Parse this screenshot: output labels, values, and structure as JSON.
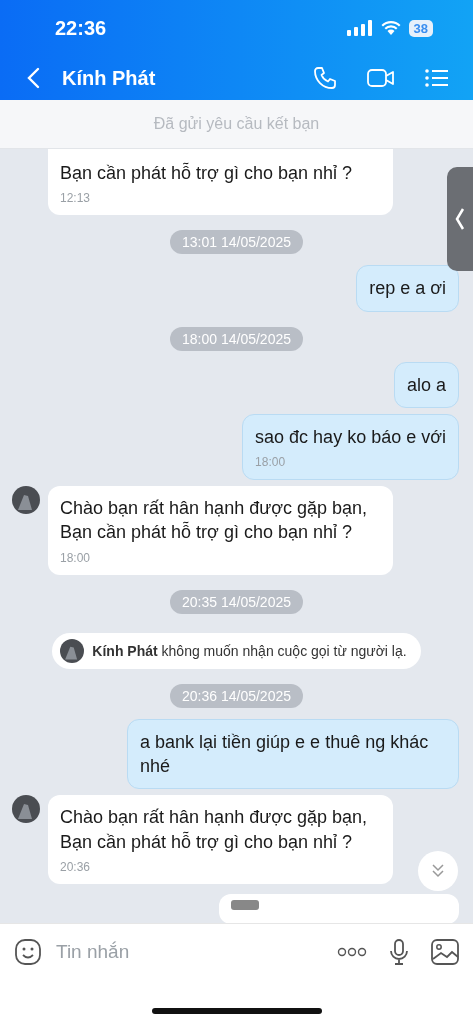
{
  "status_bar": {
    "time": "22:36",
    "battery": "38"
  },
  "header": {
    "title": "Kính Phát"
  },
  "friend_request": "Đã gửi yêu cầu kết bạn",
  "messages": [
    {
      "kind": "received",
      "text": "Bạn cần phát hỗ trợ gì cho bạn nhỉ ?",
      "time": "12:13",
      "avatar": false,
      "cut": true
    },
    {
      "kind": "time",
      "text": "13:01 14/05/2025"
    },
    {
      "kind": "sent",
      "text": "rep e a ơi"
    },
    {
      "kind": "time",
      "text": "18:00 14/05/2025"
    },
    {
      "kind": "sent",
      "text": "alo a"
    },
    {
      "kind": "sent",
      "text": "sao đc hay ko báo e với",
      "time": "18:00"
    },
    {
      "kind": "received",
      "text": "Chào bạn rất hân hạnh được gặp bạn,\nBạn cần phát hỗ trợ gì cho bạn nhỉ ?",
      "time": "18:00",
      "avatar": true,
      "cut": false
    },
    {
      "kind": "time",
      "text": "20:35 14/05/2025"
    },
    {
      "kind": "notice",
      "name": "Kính Phát",
      "text": "không muốn nhận cuộc gọi từ người lạ."
    },
    {
      "kind": "time",
      "text": "20:36 14/05/2025"
    },
    {
      "kind": "sent",
      "text": "a bank lại tiền giúp e e thuê ng khác nhé"
    },
    {
      "kind": "received",
      "text": "Chào bạn rất hân hạnh được gặp bạn,\nBạn cần phát hỗ trợ gì cho bạn nhỉ ?",
      "time": "20:36",
      "avatar": true,
      "cut": false
    },
    {
      "kind": "partial"
    }
  ],
  "composer": {
    "placeholder": "Tin nhắn"
  }
}
